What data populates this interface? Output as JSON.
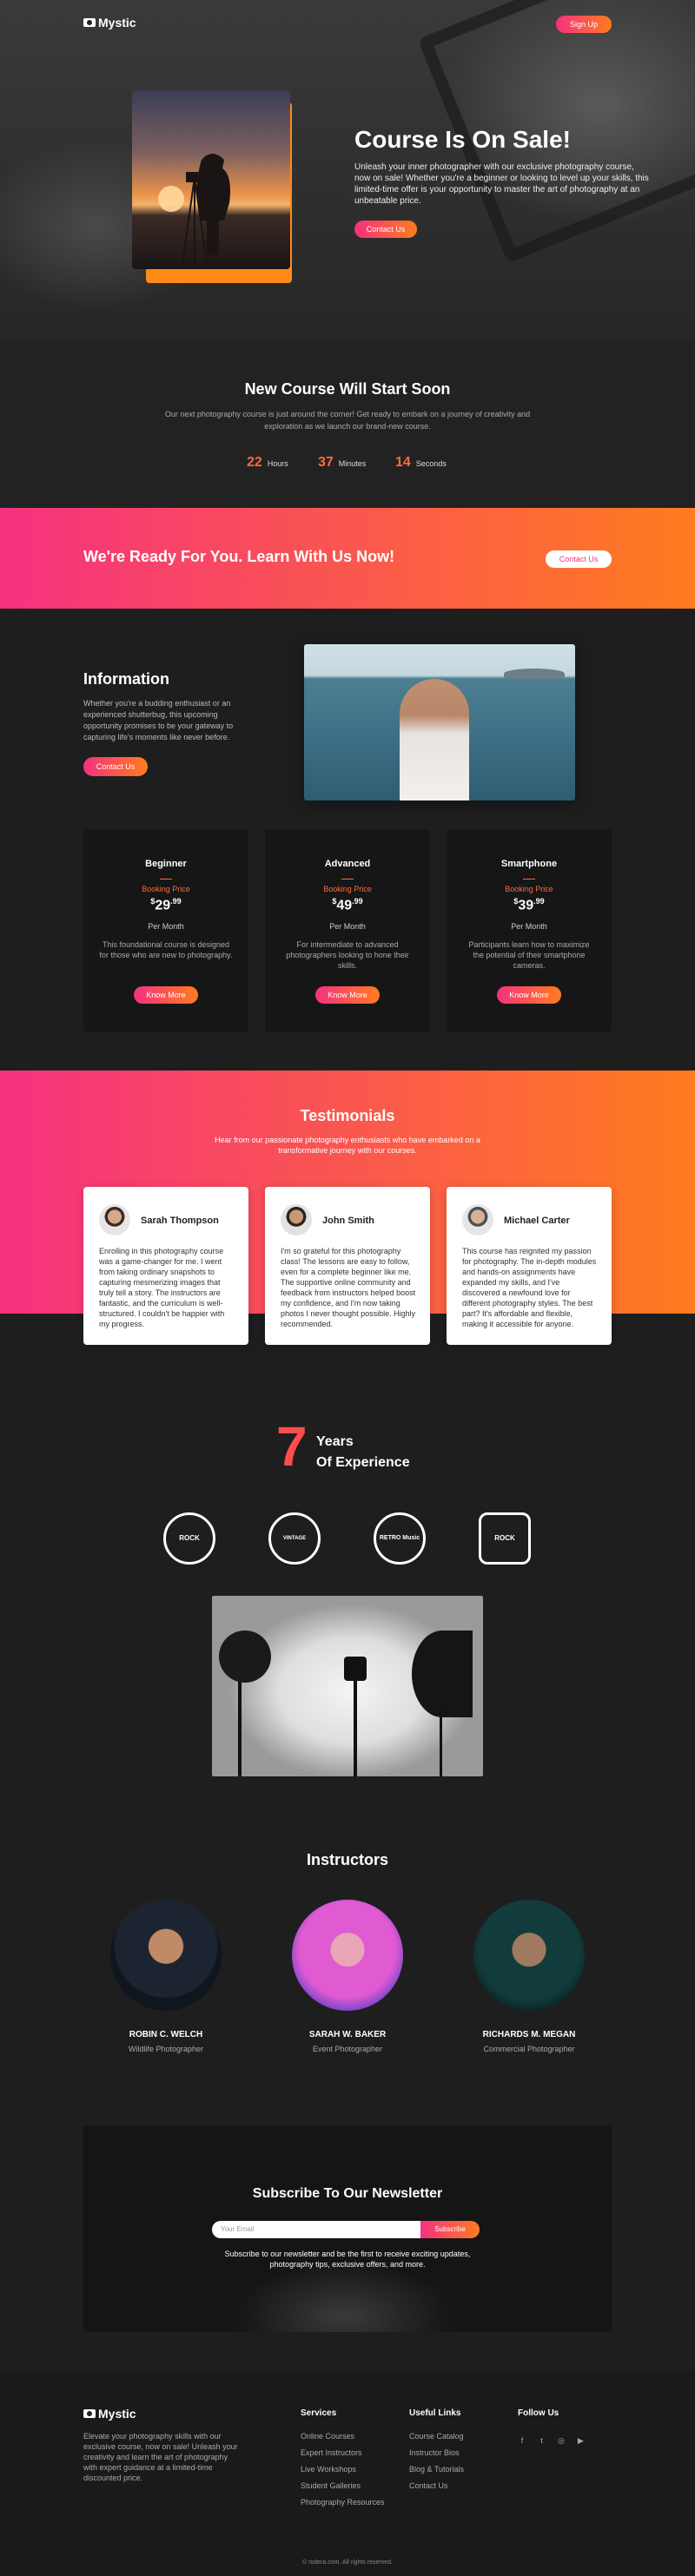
{
  "brand": {
    "name": "Mystic"
  },
  "nav": {
    "signup_label": "Sign Up"
  },
  "hero": {
    "title": "Course Is On Sale!",
    "text": "Unleash your inner photographer with our exclusive photography course, now on sale! Whether you're a beginner or looking to level up your skills, this limited-time offer is your opportunity to master the art of photography at an unbeatable price.",
    "button": "Contact Us"
  },
  "countdown": {
    "title": "New Course Will Start Soon",
    "text": "Our next photography course is just around the corner! Get ready to embark on a journey of creativity and exploration as we launch our brand-new course.",
    "items": [
      {
        "value": "22",
        "label": "Hours"
      },
      {
        "value": "37",
        "label": "Minutes"
      },
      {
        "value": "14",
        "label": "Seconds"
      }
    ]
  },
  "cta": {
    "title": "We're Ready For You. Learn With Us Now!",
    "button": "Contact Us"
  },
  "info": {
    "title": "Information",
    "text": "Whether you're a budding enthusiast or an experienced shutterbug, this upcoming opportunity promises to be your gateway to capturing life's moments like never before.",
    "button": "Contact Us"
  },
  "pricing": [
    {
      "title": "Beginner",
      "label": "Booking Price",
      "currency": "$",
      "amount": "29",
      "cents": ".99",
      "period": "Per Month",
      "desc": "This foundational course is designed for those who are new to photography.",
      "button": "Know More"
    },
    {
      "title": "Advanced",
      "label": "Booking Price",
      "currency": "$",
      "amount": "49",
      "cents": ".99",
      "period": "Per Month",
      "desc": "For intermediate to advanced photographers looking to hone their skills.",
      "button": "Know More"
    },
    {
      "title": "Smartphone",
      "label": "Booking Price",
      "currency": "$",
      "amount": "39",
      "cents": ".99",
      "period": "Per Month",
      "desc": "Participants learn how to maximize the potential of their smartphone cameras.",
      "button": "Know More"
    }
  ],
  "testimonials": {
    "title": "Testimonials",
    "text": "Hear from our passionate photography enthusiasts who have embarked on a transformative journey with our courses.",
    "items": [
      {
        "name": "Sarah Thompson",
        "text": "Enrolling in this photography course was a game-changer for me. I went from taking ordinary snapshots to capturing mesmerizing images that truly tell a story. The instructors are fantastic, and the curriculum is well-structured. I couldn't be happier with my progress."
      },
      {
        "name": "John Smith",
        "text": "I'm so grateful for this photography class! The lessons are easy to follow, even for a complete beginner like me. The supportive online community and feedback from instructors helped boost my confidence, and I'm now taking photos I never thought possible. Highly recommended."
      },
      {
        "name": "Michael Carter",
        "text": "This course has reignited my passion for photography. The in-depth modules and hands-on assignments have expanded my skills, and I've discovered a newfound love for different photography styles. The best part? It's affordable and flexible, making it accessible for anyone."
      }
    ]
  },
  "experience": {
    "number": "7",
    "line1": "Years",
    "line2": "Of Experience"
  },
  "badges": [
    {
      "text": "ROCK",
      "icon": "rock-badge-icon"
    },
    {
      "text": "VINTAGE",
      "icon": "vintage-badge-icon"
    },
    {
      "text": "RETRO Music",
      "icon": "retro-badge-icon"
    },
    {
      "text": "ROCK",
      "icon": "guitar-badge-icon"
    }
  ],
  "instructors": {
    "title": "Instructors",
    "items": [
      {
        "name": "ROBIN C. WELCH",
        "role": "Wildlife Photographer"
      },
      {
        "name": "SARAH W. BAKER",
        "role": "Event Photographer"
      },
      {
        "name": "RICHARDS M. MEGAN",
        "role": "Commercial Photographer"
      }
    ]
  },
  "newsletter": {
    "title": "Subscribe To Our Newsletter",
    "placeholder": "Your Email",
    "button": "Subscribe",
    "text": "Subscribe to our newsletter and be the first to receive exciting updates, photography tips, exclusive offers, and more."
  },
  "footer": {
    "desc": "Elevate your photography skills with our exclusive course, now on sale! Unleash your creativity and learn the art of photography with expert guidance at a limited-time discounted price.",
    "services": {
      "title": "Services",
      "links": [
        "Online Courses",
        "Expert Instructors",
        "Live Workshops",
        "Student Galleries",
        "Photography Resources"
      ]
    },
    "useful": {
      "title": "Useful Links",
      "links": [
        "Course Catalog",
        "Instructor Bios",
        "Blog & Tutorials",
        "Contact Us"
      ]
    },
    "follow": {
      "title": "Follow Us",
      "icons": [
        "facebook-icon",
        "twitter-icon",
        "instagram-icon",
        "youtube-icon"
      ]
    },
    "copyright": "© rodera.com. All rights reserved."
  }
}
